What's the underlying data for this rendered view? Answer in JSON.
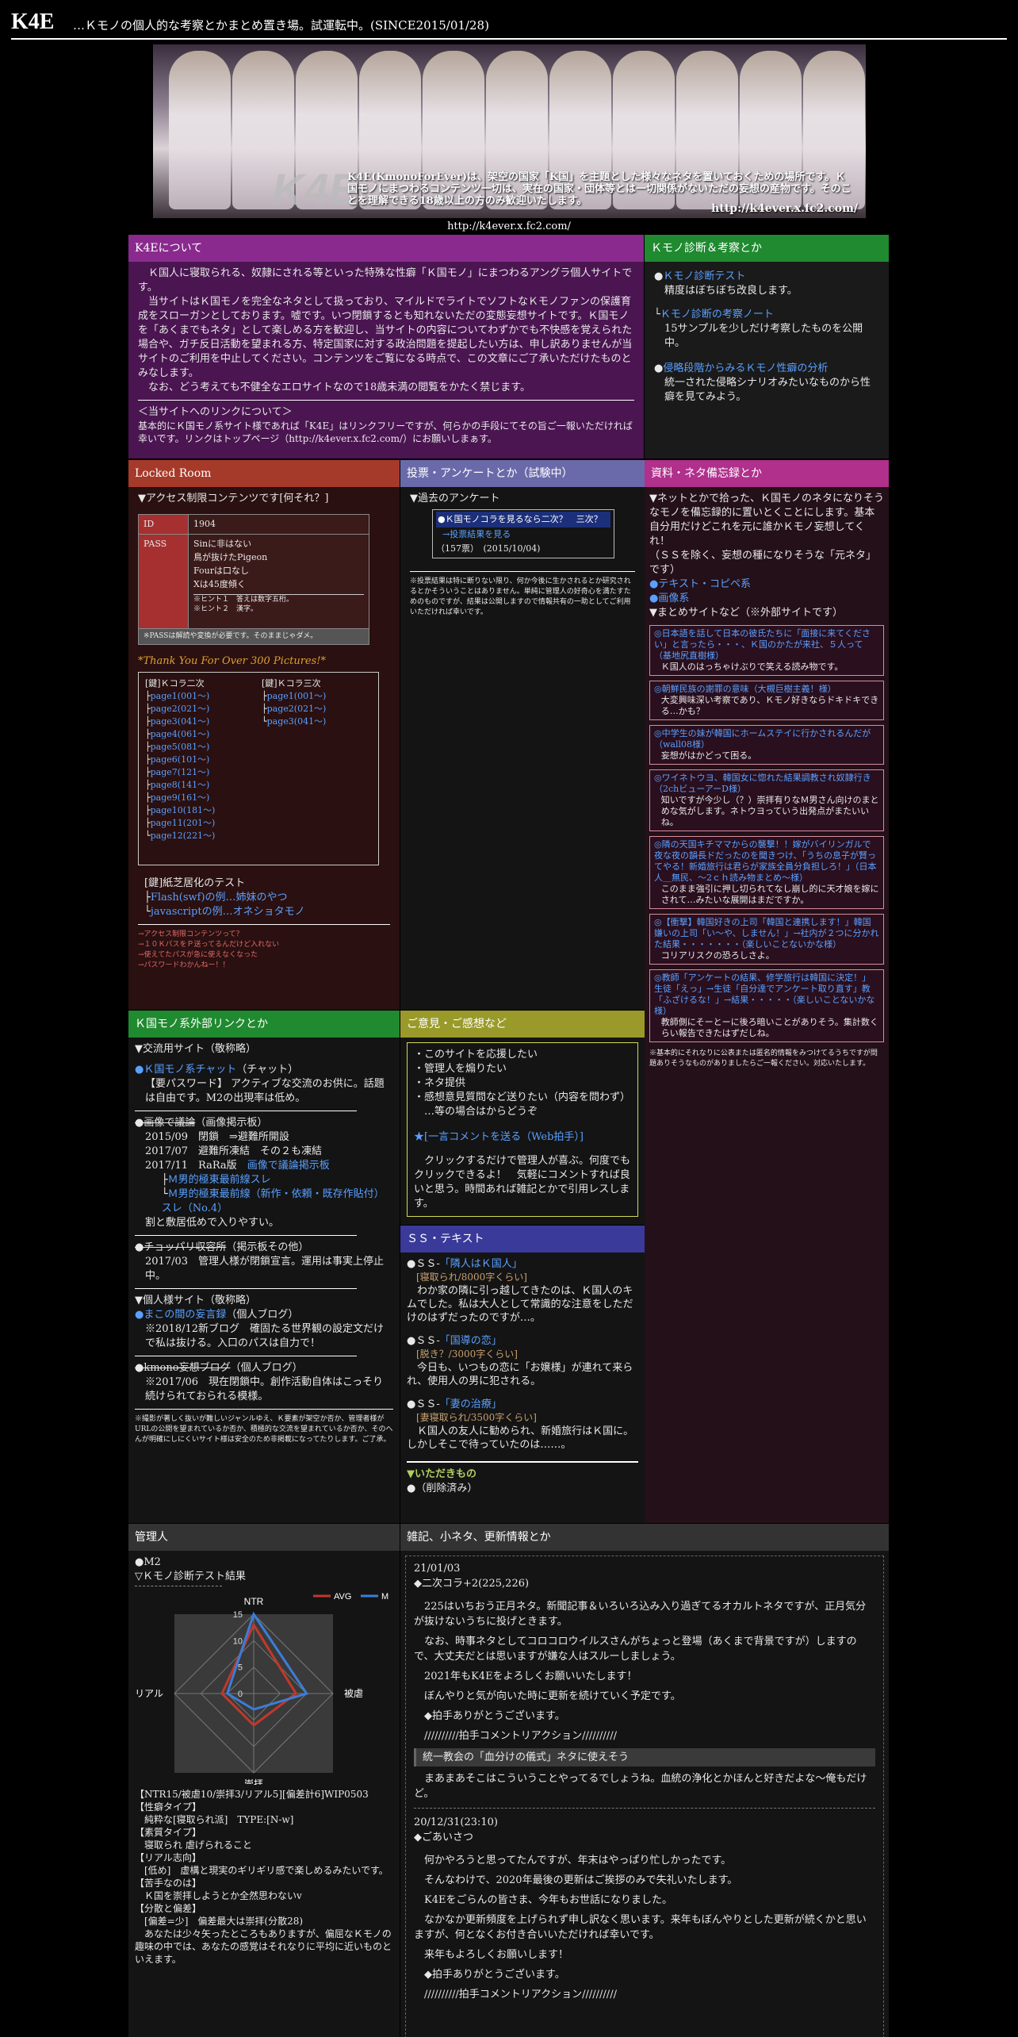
{
  "header": {
    "logo": "K4E",
    "subtitle": "…Ｋモノの個人的な考察とかまとめ置き場。試運転中。(SINCE2015/01/28)"
  },
  "banner": {
    "logo_text": "K4E",
    "text": "K4E(KmonoForEver)は、架空の国家「K国」を主題とした様々なネタを置いておくための場所です。Ｋ国モノにまつわるコンテンツ一切は、実在の国家・団体等とは一切関係がないただの妄想の産物です。そのことを理解できる18歳以上の方のみ歓迎いたします。",
    "url": "http://k4ever.x.fc2.com/"
  },
  "caption_url": "http://k4ever.x.fc2.com/",
  "about": {
    "title": "K4Eについて",
    "p1": "Ｋ国人に寝取られる、奴隷にされる等といった特殊な性癖「Ｋ国モノ」にまつわるアングラ個人サイトです。",
    "p2": "当サイトはＫ国モノを完全なネタとして扱っており、マイルドでライトでソフトなＫモノファンの保護育成をスローガンとしております。嘘です。いつ閉鎖するとも知れないただの変態妄想サイトです。Ｋ国モノを「あくまでもネタ」として楽しめる方を歓迎し、当サイトの内容についてわずかでも不快感を覚えられた場合や、ガチ反日活動を望まれる方、特定国家に対する政治問題を提起したい方は、申し訳ありませんが当サイトのご利用を中止してください。コンテンツをご覧になる時点で、この文章にご了承いただけたものとみなします。",
    "p3": "なお、どう考えても不健全なエロサイトなので18歳未満の閲覧をかたく禁じます。",
    "link_title": "＜当サイトへのリンクについて＞",
    "link_text": "基本的にＫ国モノ系サイト様であれば「K4E」はリンクフリーですが、何らかの手段にてその旨ご一報いただければ幸いです。リンクはトップページ（http://k4ever.x.fc2.com/）にお願いしまぁす。"
  },
  "diagnosis": {
    "title": "Ｋモノ診断＆考察とか",
    "items": [
      {
        "label": "Ｋモノ診断テスト",
        "desc": "精度はぼちぼち改良します。"
      },
      {
        "label": "Ｋモノ診断の考察ノート",
        "desc": "15サンプルを少しだけ考察したものを公開中。"
      },
      {
        "label": "侵略段階からみるＫモノ性癖の分析",
        "desc": "統一された侵略シナリオみたいなものから性癖を見てみよう。"
      }
    ]
  },
  "locked": {
    "title": "Locked Room",
    "heading": "▼アクセス制限コンテンツです[何それ？]",
    "id_label": "ID",
    "id_value": "1904",
    "pass_label": "PASS",
    "pass_lines": [
      "Sinに非はない",
      "鳥が抜けたPigeon",
      "Fourは口なし",
      "Xは45度傾く"
    ],
    "hints": [
      "※ヒント１　答えは数字五桁。",
      "※ヒント２　漢字。"
    ],
    "note": "※PASSは解読や変換が必要です。そのままじゃダメ。",
    "thanks": "*Thank You For Over 300 Pictures!*",
    "col1_title": "[鍵]Ｋコラ二次",
    "col1": [
      "page1(001～)",
      "page2(021～)",
      "page3(041～)",
      "page4(061～)",
      "page5(081～)",
      "page6(101～)",
      "page7(121～)",
      "page8(141～)",
      "page9(161～)",
      "page10(181～)",
      "page11(201～)",
      "page12(221～)"
    ],
    "col2_title": "[鍵]Ｋコラ三次",
    "col2": [
      "page1(001～)",
      "page2(021～)",
      "page3(041～)"
    ],
    "test_title": "[鍵]紙芝居化のテスト",
    "test_items": [
      "Flash(swf)の例…姉妹のやつ",
      "javascriptの例…オネショタモノ"
    ],
    "footer_links": [
      "→アクセス制限コンテンツって？",
      "→１０ＫパスをＰ送ってるんだけど入れない",
      "→使えてたパスが急に使えなくなった",
      "→パスワードわかんねー！！"
    ]
  },
  "vote": {
    "title": "投票・アンケートとか（試験中）",
    "heading": "▼過去のアンケート",
    "q": "●Ｋ国モノコラを見るなら二次？　三次？",
    "result_link": "→投票結果を見る",
    "meta": "（157票）　(2015/10/04)",
    "note": "※投票結果は特に断りない限り、何か今後に生かされるとか研究されるとかそういうことはありません。単純に管理人の好奇心を満たすためのものですが、結果は公開しますので情報共有の一助としてご利用いただければ幸いです。"
  },
  "materials": {
    "title": "資料・ネタ備忘録とか",
    "intro": "▼ネットとかで拾った、Ｋ国モノのネタになりそうなモノを備忘録的に置いとくことにします。基本自分用だけどこれを元に誰かＫモノ妄想してくれ！",
    "intro2": "（ＳＳを除く、妄想の種になりそうな「元ネタ」です）",
    "links": [
      "●テキスト・コピペ系",
      "●画像系"
    ],
    "summary_heading": "▼まとめサイトなど（※外部サイトです）",
    "entries": [
      {
        "title": "◎日本語を話して日本の彼氏たちに「面接に来てください」と言ったら・・・、Ｋ国のかたが来社、５人って（基地尻直樹様）",
        "desc": "Ｋ国人のはっちゃけぶりで笑える読み物です。"
      },
      {
        "title": "◎朝鮮民族の謝罪の意味（大槻巨樹主義！様）",
        "desc": "大変興味深い考察であり、Ｋモノ好きならドキドキできる…かも？"
      },
      {
        "title": "◎中学生の妹が韓国にホームステイに行かされるんだが（wall08様）",
        "desc": "妄想がはかどって困る。"
      },
      {
        "title": "◎ワイネトウヨ、韓国女に惚れた結果調教され奴隷行き（2chビューアーD様）",
        "desc": "知いですが今少し（？）崇拝有りなＭ男さん向けのまとめな気がします。ネトウヨっていう出発点がまたいいね。"
      },
      {
        "title": "◎隣の天国キチママからの襲撃！！嫁がバイリンガルで夜な夜の韻長ドだったのを聞きつけ、「うちの息子が賢ってやる！新婚旅行は君らが家族全員分負担しろ！」（日本人＿無民、～2ｃｈ読み物まとめ～様）",
        "desc": "このまま強引に押し切られてなし崩し的に天才娘を嫁にされて…みたいな展開はまだですか。"
      },
      {
        "title": "◎【衝撃】韓国好きの上司「韓国と連携します！」韓国嫌いの上司「い～や、しません！」→社内が２つに分かれた結果・・・・・・・（楽しいことないかな様）",
        "desc": "コリアリスクの恐ろしさよ。"
      },
      {
        "title": "◎教師「アンケートの結果、修学旅行は韓国に決定！」生徒「えっ」→生徒「自分達でアンケート取り直す」教「ふざけるな！」→結果・・・・・（楽しいことないかな様）",
        "desc": "教師側にそーとーに後ろ暗いことがありそう。集計数くらい報告できたはずだしね。"
      }
    ],
    "note": "※基本的にそれなりに公表または匿名的情報をみつけてるうちですが問題ありそうなものがありましたらご一報ください。対応いたします。"
  },
  "external": {
    "title": "Ｋ国モノ系外部リンクとか",
    "heading": "▼交流用サイト（敬称略）",
    "e1_label": "●Ｋ国モノ系チャット",
    "e1_tag": "（チャット）",
    "e1_desc": "【要パスワード】 アクティブな交流のお供に。話題は自由です。M2の出現率は低め。",
    "e2_label": "●画像で議論",
    "e2_tag": "（画像掲示板）",
    "e2_lines": [
      "2015/09　閉鎖　⇒避難所開設",
      "2017/07　避難所凍結　その２も凍結",
      "2017/11　RaRa版"
    ],
    "e2_link": "画像で議論掲示板",
    "e2_sublinks": [
      "Ｍ男的極東最前線スレ",
      "Ｍ男的極東最前線（新作・依頼・既存作貼付）スレ（No.4）"
    ],
    "e2_tail": "割と敷居低めで入りやすい。",
    "e3_label": "●チョッパリ収容所",
    "e3_tag": "（掲示板その他）",
    "e3_desc": "2017/03　管理人様が閉鎖宣言。運用は事実上停止中。",
    "heading2": "▼個人様サイト（敬称略）",
    "e4_label": "●まこの間の妄言録",
    "e4_tag": "（個人ブログ）",
    "e4_desc": "※2018/12新ブログ　確固たる世界観の設定文だけで私は抜ける。入口のパスは自力で！",
    "e5_label": "●kmono妄想ブログ",
    "e5_tag": "（個人ブログ）",
    "e5_desc": "※2017/06　現在閉鎖中。創作活動自体はこっそり続けられておられる模様。",
    "note": "※撮影が著しく抜いが難しいジャンルゆえ、Ｋ要素が架空か否か、管理者様がURLの公開を望まれているか否か、積極的な交流を望まれているか否か、そのへんが明確にしにくいサイト様は安全のため非掲載になってたりします。ご了承。"
  },
  "opinion": {
    "title": "ご意見・ご感想など",
    "items": [
      "・このサイトを応援したい",
      "・管理人を煽りたい",
      "・ネタ提供",
      "・感想意見質問など送りたい（内容を問わず）",
      "　…等の場合はからどうぞ"
    ],
    "link": "★[一言コメントを送る（Web拍手）]",
    "desc": "クリックするだけで管理人が喜ぶ。何度でもクリックできるよ！　気軽にコメントすれば良いと思う。時間あれば雑記とかで引用レスします。"
  },
  "ss": {
    "title": "ＳＳ・テキスト",
    "items": [
      {
        "head": "●ＳＳ-",
        "label": "「隣人はＫ国人」",
        "sub": "[寝取られ/8000字くらい]",
        "desc": "わか家の隣に引っ越してきたのは、Ｋ国人のキムでした。私は大人として常識的な注意をしただけのはずだったのですが…。"
      },
      {
        "head": "●ＳＳ-",
        "label": "「国導の恋」",
        "sub": "[脱き？/3000字くらい]",
        "desc": "今日も、いつもの恋に「お嬢様」が連れて来られ、使用人の男に犯される。"
      },
      {
        "head": "●ＳＳ-",
        "label": "「妻の治療」",
        "sub": "[妻寝取られ/3500字くらい]",
        "desc": "Ｋ国人の友人に勧められ、新婚旅行はＫ国に。しかしそこで待っていたのは……。"
      }
    ],
    "bottom_label": "▼いただきもの",
    "bottom_desc": "●（削除済み）"
  },
  "admin": {
    "title": "管理人",
    "name": "●M2",
    "result_label": "▽Ｋモノ診断テスト結果",
    "result_text": "【NTR15/被虐10/崇拝3/リアル5][偏差計6]WIP0503",
    "lines": [
      "【性癖タイプ】",
      "　純粋な[寝取られ派]　TYPE:[N-w]",
      "【素質タイプ】",
      "　寝取られ 虐げられること",
      "【リアル志向】",
      "　[低め]　虚構と現実のギリギリ感で楽しめるみたいです。",
      "【苦手なのは】",
      "　Ｋ国を崇拝しようとか全然思わないv",
      "【分散と偏差】",
      "　[偏差=少]　偏差最大は崇拝(分散28)",
      "　あなたは少々矢ったところもありますが、偏屈なＫモノの趣味の中では、あなたの感覚はそれなりに平均に近いものといえます。"
    ]
  },
  "chart_data": {
    "type": "radar",
    "categories": [
      "NTR",
      "被虐",
      "崇拝",
      "リアル"
    ],
    "series": [
      {
        "name": "AVG",
        "values": [
          13,
          8,
          6,
          6
        ],
        "color": "#c0392b"
      },
      {
        "name": "M2",
        "values": [
          15,
          10,
          3,
          5
        ],
        "color": "#3b7dd8"
      }
    ],
    "ticks": [
      0,
      5,
      10,
      15
    ],
    "rmax": 15
  },
  "diary": {
    "title": "雑記、小ネタ、更新情報とか",
    "entries": [
      {
        "date": "21/01/03",
        "headline": "◆二次コラ+2(225,226)",
        "paras": [
          "225はいちおう正月ネタ。新聞記事＆いろいろ込み入り過ぎてるオカルトネタですが、正月気分が抜けないうちに投げときます。",
          "なお、時事ネタとしてコロコロウイルスさんがちょっと登場（あくまで背景ですが）しますので、大丈夫だとは思いますが嫌な人はスルーしましょう。",
          "2021年もK4Eをよろしくお願いいたします！",
          "ぼんやりと気が向いた時に更新を続けていく予定です。",
          "◆拍手ありがとうございます。",
          "//////////拍手コメントリアクション//////////"
        ],
        "quote": "統一教会の「血分けの儀式」ネタに使えそう",
        "reply": "まあまあそこはこういうことやってるでしょうね。血統の浄化とかほんと好きだよな～俺もだけど。"
      },
      {
        "date": "20/12/31(23:10)",
        "headline": "◆ごあいさつ",
        "paras": [
          "何かやろうと思ってたんですが、年末はやっぱり忙しかったです。",
          "そんなわけで、2020年最後の更新はご挨拶のみで失礼いたします。",
          "K4Eをごらんの皆さま、今年もお世話になりました。",
          "なかなか更新頻度を上げられず申し訳なく思います。来年もぼんやりとした更新が続くかと思いますが、何となくお付き合いいただければ幸いです。",
          "来年もよろしくお願いします！",
          "◆拍手ありがとうございます。",
          "//////////拍手コメントリアクション//////////"
        ]
      }
    ]
  }
}
